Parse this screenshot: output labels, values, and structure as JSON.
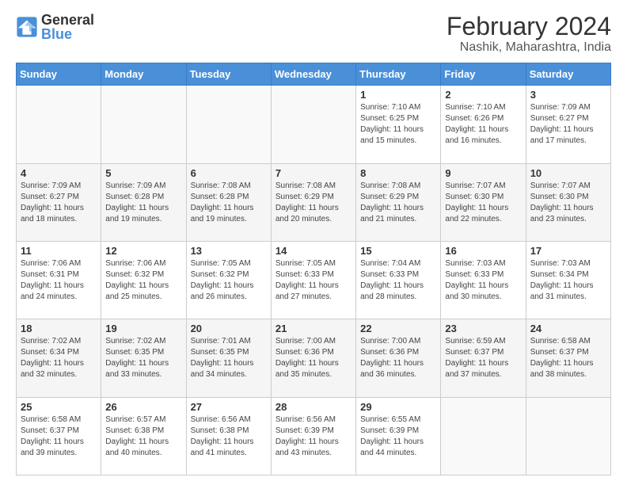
{
  "logo": {
    "general": "General",
    "blue": "Blue"
  },
  "header": {
    "title": "February 2024",
    "subtitle": "Nashik, Maharashtra, India"
  },
  "weekdays": [
    "Sunday",
    "Monday",
    "Tuesday",
    "Wednesday",
    "Thursday",
    "Friday",
    "Saturday"
  ],
  "weeks": [
    [
      {
        "day": "",
        "info": ""
      },
      {
        "day": "",
        "info": ""
      },
      {
        "day": "",
        "info": ""
      },
      {
        "day": "",
        "info": ""
      },
      {
        "day": "1",
        "info": "Sunrise: 7:10 AM\nSunset: 6:25 PM\nDaylight: 11 hours and 15 minutes."
      },
      {
        "day": "2",
        "info": "Sunrise: 7:10 AM\nSunset: 6:26 PM\nDaylight: 11 hours and 16 minutes."
      },
      {
        "day": "3",
        "info": "Sunrise: 7:09 AM\nSunset: 6:27 PM\nDaylight: 11 hours and 17 minutes."
      }
    ],
    [
      {
        "day": "4",
        "info": "Sunrise: 7:09 AM\nSunset: 6:27 PM\nDaylight: 11 hours and 18 minutes."
      },
      {
        "day": "5",
        "info": "Sunrise: 7:09 AM\nSunset: 6:28 PM\nDaylight: 11 hours and 19 minutes."
      },
      {
        "day": "6",
        "info": "Sunrise: 7:08 AM\nSunset: 6:28 PM\nDaylight: 11 hours and 19 minutes."
      },
      {
        "day": "7",
        "info": "Sunrise: 7:08 AM\nSunset: 6:29 PM\nDaylight: 11 hours and 20 minutes."
      },
      {
        "day": "8",
        "info": "Sunrise: 7:08 AM\nSunset: 6:29 PM\nDaylight: 11 hours and 21 minutes."
      },
      {
        "day": "9",
        "info": "Sunrise: 7:07 AM\nSunset: 6:30 PM\nDaylight: 11 hours and 22 minutes."
      },
      {
        "day": "10",
        "info": "Sunrise: 7:07 AM\nSunset: 6:30 PM\nDaylight: 11 hours and 23 minutes."
      }
    ],
    [
      {
        "day": "11",
        "info": "Sunrise: 7:06 AM\nSunset: 6:31 PM\nDaylight: 11 hours and 24 minutes."
      },
      {
        "day": "12",
        "info": "Sunrise: 7:06 AM\nSunset: 6:32 PM\nDaylight: 11 hours and 25 minutes."
      },
      {
        "day": "13",
        "info": "Sunrise: 7:05 AM\nSunset: 6:32 PM\nDaylight: 11 hours and 26 minutes."
      },
      {
        "day": "14",
        "info": "Sunrise: 7:05 AM\nSunset: 6:33 PM\nDaylight: 11 hours and 27 minutes."
      },
      {
        "day": "15",
        "info": "Sunrise: 7:04 AM\nSunset: 6:33 PM\nDaylight: 11 hours and 28 minutes."
      },
      {
        "day": "16",
        "info": "Sunrise: 7:03 AM\nSunset: 6:33 PM\nDaylight: 11 hours and 30 minutes."
      },
      {
        "day": "17",
        "info": "Sunrise: 7:03 AM\nSunset: 6:34 PM\nDaylight: 11 hours and 31 minutes."
      }
    ],
    [
      {
        "day": "18",
        "info": "Sunrise: 7:02 AM\nSunset: 6:34 PM\nDaylight: 11 hours and 32 minutes."
      },
      {
        "day": "19",
        "info": "Sunrise: 7:02 AM\nSunset: 6:35 PM\nDaylight: 11 hours and 33 minutes."
      },
      {
        "day": "20",
        "info": "Sunrise: 7:01 AM\nSunset: 6:35 PM\nDaylight: 11 hours and 34 minutes."
      },
      {
        "day": "21",
        "info": "Sunrise: 7:00 AM\nSunset: 6:36 PM\nDaylight: 11 hours and 35 minutes."
      },
      {
        "day": "22",
        "info": "Sunrise: 7:00 AM\nSunset: 6:36 PM\nDaylight: 11 hours and 36 minutes."
      },
      {
        "day": "23",
        "info": "Sunrise: 6:59 AM\nSunset: 6:37 PM\nDaylight: 11 hours and 37 minutes."
      },
      {
        "day": "24",
        "info": "Sunrise: 6:58 AM\nSunset: 6:37 PM\nDaylight: 11 hours and 38 minutes."
      }
    ],
    [
      {
        "day": "25",
        "info": "Sunrise: 6:58 AM\nSunset: 6:37 PM\nDaylight: 11 hours and 39 minutes."
      },
      {
        "day": "26",
        "info": "Sunrise: 6:57 AM\nSunset: 6:38 PM\nDaylight: 11 hours and 40 minutes."
      },
      {
        "day": "27",
        "info": "Sunrise: 6:56 AM\nSunset: 6:38 PM\nDaylight: 11 hours and 41 minutes."
      },
      {
        "day": "28",
        "info": "Sunrise: 6:56 AM\nSunset: 6:39 PM\nDaylight: 11 hours and 43 minutes."
      },
      {
        "day": "29",
        "info": "Sunrise: 6:55 AM\nSunset: 6:39 PM\nDaylight: 11 hours and 44 minutes."
      },
      {
        "day": "",
        "info": ""
      },
      {
        "day": "",
        "info": ""
      }
    ]
  ]
}
